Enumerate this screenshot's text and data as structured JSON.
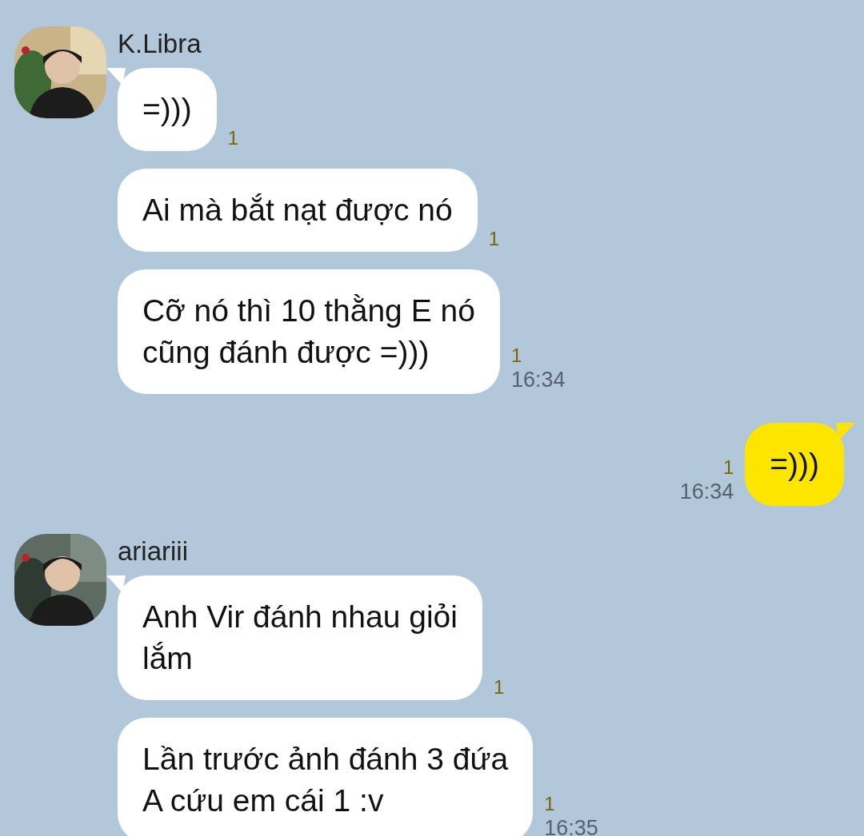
{
  "messages": [
    {
      "kind": "incoming",
      "sender": "K.Libra",
      "avatar": {
        "kind": "picture"
      },
      "bubbles": [
        {
          "text": "=)))",
          "unread": "1"
        },
        {
          "text": "Ai mà bắt nạt được nó",
          "unread": "1"
        },
        {
          "text": "Cỡ nó thì 10 thằng E nó\ncũng đánh được =)))",
          "unread": "1",
          "time": "16:34"
        }
      ]
    },
    {
      "kind": "outgoing",
      "bubbles": [
        {
          "text": "=)))",
          "unread": "1",
          "time": "16:34"
        }
      ]
    },
    {
      "kind": "incoming",
      "sender": "ariariii",
      "avatar": {
        "kind": "picture"
      },
      "bubbles": [
        {
          "text": "Anh Vir đánh nhau giỏi\nlắm",
          "unread": "1"
        },
        {
          "text": "Lần trước ảnh đánh 3 đứa\nA cứu em cái 1 :v",
          "unread": "1",
          "time": "16:35"
        }
      ]
    }
  ]
}
